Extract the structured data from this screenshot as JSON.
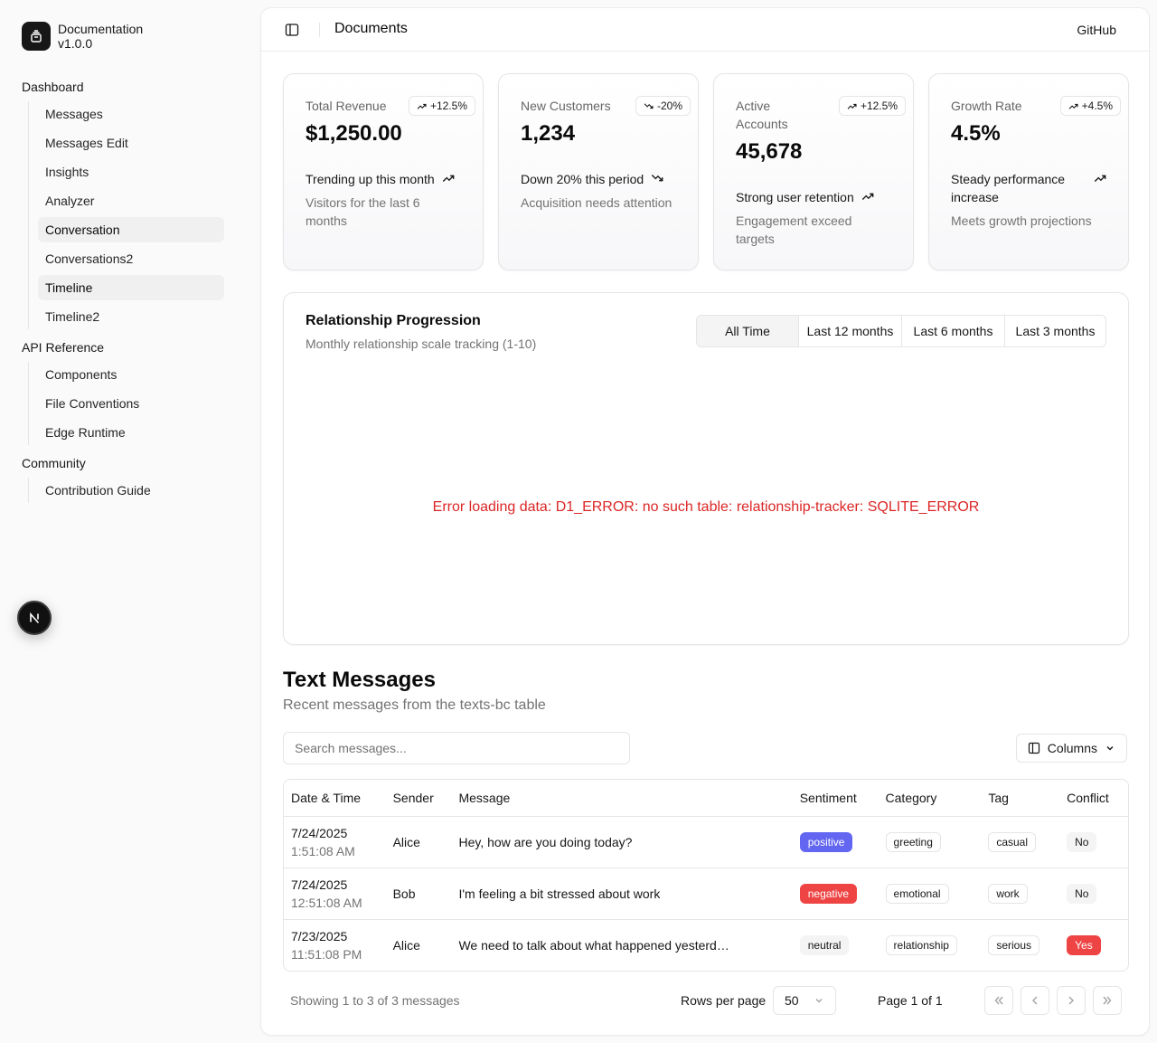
{
  "brand": {
    "name": "Documentation",
    "version": "v1.0.0"
  },
  "sidebar": {
    "groups": [
      {
        "title": "Dashboard",
        "items": [
          {
            "label": "Messages",
            "active": false
          },
          {
            "label": "Messages Edit",
            "active": false
          },
          {
            "label": "Insights",
            "active": false
          },
          {
            "label": "Analyzer",
            "active": false
          },
          {
            "label": "Conversation",
            "active": true
          },
          {
            "label": "Conversations2",
            "active": false
          },
          {
            "label": "Timeline",
            "active": true
          },
          {
            "label": "Timeline2",
            "active": false
          }
        ]
      },
      {
        "title": "API Reference",
        "items": [
          {
            "label": "Components",
            "active": false
          },
          {
            "label": "File Conventions",
            "active": false
          },
          {
            "label": "Edge Runtime",
            "active": false
          }
        ]
      },
      {
        "title": "Community",
        "items": [
          {
            "label": "Contribution Guide",
            "active": false
          }
        ]
      }
    ],
    "badge": "N"
  },
  "topbar": {
    "title": "Documents",
    "github": "GitHub"
  },
  "cards": [
    {
      "label": "Total Revenue",
      "badge": "+12.5%",
      "badge_dir": "up",
      "value": "$1,250.00",
      "trend": "Trending up this month",
      "trend_dir": "up",
      "desc": "Visitors for the last 6 months"
    },
    {
      "label": "New Customers",
      "badge": "-20%",
      "badge_dir": "down",
      "value": "1,234",
      "trend": "Down 20% this period",
      "trend_dir": "down",
      "desc": "Acquisition needs attention"
    },
    {
      "label": "Active Accounts",
      "badge": "+12.5%",
      "badge_dir": "up",
      "value": "45,678",
      "trend": "Strong user retention",
      "trend_dir": "up",
      "desc": "Engagement exceed targets"
    },
    {
      "label": "Growth Rate",
      "badge": "+4.5%",
      "badge_dir": "up",
      "value": "4.5%",
      "trend": "Steady performance increase",
      "trend_dir": "up",
      "desc": "Meets growth projections"
    }
  ],
  "chart": {
    "title": "Relationship Progression",
    "subtitle": "Monthly relationship scale tracking (1-10)",
    "ranges": [
      "All Time",
      "Last 12 months",
      "Last 6 months",
      "Last 3 months"
    ],
    "selected_range": "All Time",
    "error": "Error loading data: D1_ERROR: no such table: relationship-tracker: SQLITE_ERROR"
  },
  "messages": {
    "title": "Text Messages",
    "subtitle": "Recent messages from the texts-bc table",
    "search_placeholder": "Search messages...",
    "columns_label": "Columns",
    "headers": [
      "Date & Time",
      "Sender",
      "Message",
      "Sentiment",
      "Category",
      "Tag",
      "Conflict"
    ],
    "rows": [
      {
        "date": "7/24/2025",
        "time": "1:51:08 AM",
        "sender": "Alice",
        "message": "Hey, how are you doing today?",
        "sentiment": "positive",
        "category": "greeting",
        "tag": "casual",
        "conflict": "No"
      },
      {
        "date": "7/24/2025",
        "time": "12:51:08 AM",
        "sender": "Bob",
        "message": "I'm feeling a bit stressed about work",
        "sentiment": "negative",
        "category": "emotional",
        "tag": "work",
        "conflict": "No"
      },
      {
        "date": "7/23/2025",
        "time": "11:51:08 PM",
        "sender": "Alice",
        "message": "We need to talk about what happened yesterd…",
        "sentiment": "neutral",
        "category": "relationship",
        "tag": "serious",
        "conflict": "Yes"
      }
    ],
    "showing": "Showing 1 to 3 of 3 messages",
    "rows_per_page_label": "Rows per page",
    "rows_per_page": "50",
    "page_label": "Page 1 of 1"
  },
  "colors": {
    "positive": "#6366f1",
    "negative": "#ef4444",
    "error": "#dc2626"
  }
}
